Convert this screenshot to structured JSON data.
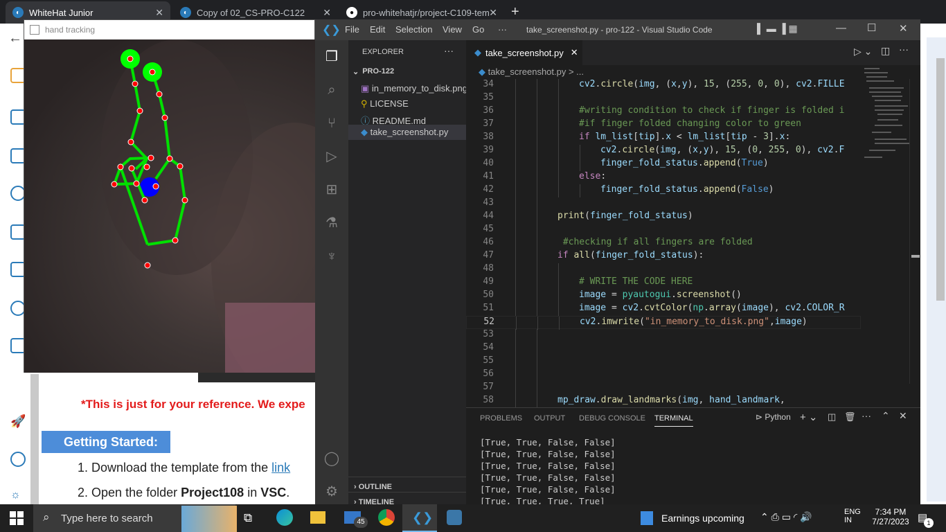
{
  "browser": {
    "tabs": [
      {
        "title": "WhiteHat Junior",
        "active": true
      },
      {
        "title": "Copy of 02_CS-PRO-C122",
        "active": false
      },
      {
        "title": "pro-whitehatjr/project-C109-tem",
        "active": false
      }
    ],
    "page": {
      "reference_text": "*This is just for your reference. We expe",
      "section_title": "Getting Started:",
      "steps": [
        {
          "num": "1.",
          "pre": "Download the template from the ",
          "link": "link",
          "bold": "",
          "post": ""
        },
        {
          "num": "2.",
          "pre": "Open the folder ",
          "link": "",
          "bold": "Project108",
          "mid": " in ",
          "bold2": "VSC",
          "post": "."
        }
      ]
    }
  },
  "hand_window": {
    "title": "hand tracking"
  },
  "vscode": {
    "title": "take_screenshot.py - pro-122 - Visual Studio Code",
    "menu": [
      "File",
      "Edit",
      "Selection",
      "View",
      "Go",
      "···"
    ],
    "explorer": {
      "header": "EXPLORER",
      "folder": "PRO-122",
      "files": [
        "in_memory_to_disk.png",
        "LICENSE",
        "README.md",
        "take_screenshot.py"
      ],
      "outline": "OUTLINE",
      "timeline": "TIMELINE"
    },
    "editor_tab": "take_screenshot.py",
    "breadcrumb": "take_screenshot.py > ...",
    "current_line": "52",
    "lines": [
      {
        "n": "34",
        "html": "<span class='vr'>cv2</span>.<span class='fn'>circle</span>(<span class='vr'>img</span>, (<span class='vr'>x</span>,<span class='vr'>y</span>), <span class='nm'>15</span>, (<span class='nm'>255</span>, <span class='nm'>0</span>, <span class='nm'>0</span>), <span class='vr'>cv2</span>.<span class='vr'>FILLE</span>",
        "indent": 4
      },
      {
        "n": "35",
        "html": "",
        "indent": 4
      },
      {
        "n": "36",
        "html": "<span class='cm'>#writing condition to check if finger is folded i</span>",
        "indent": 4
      },
      {
        "n": "37",
        "html": "<span class='cm'>#if finger folded changing color to green</span>",
        "indent": 4
      },
      {
        "n": "38",
        "html": "<span class='kw'>if</span> <span class='vr'>lm_list</span>[<span class='vr'>tip</span>].<span class='vr'>x</span> &lt; <span class='vr'>lm_list</span>[<span class='vr'>tip</span> - <span class='nm'>3</span>].<span class='vr'>x</span>:",
        "indent": 4
      },
      {
        "n": "39",
        "html": "<span class='vr'>cv2</span>.<span class='fn'>circle</span>(<span class='vr'>img</span>, (<span class='vr'>x</span>,<span class='vr'>y</span>), <span class='nm'>15</span>, (<span class='nm'>0</span>, <span class='nm'>255</span>, <span class='nm'>0</span>), <span class='vr'>cv2</span>.<span class='vr'>F</span>",
        "indent": 5
      },
      {
        "n": "40",
        "html": "<span class='vr'>finger_fold_status</span>.<span class='fn'>append</span>(<span class='bl'>True</span>)",
        "indent": 5
      },
      {
        "n": "41",
        "html": "<span class='kw'>else</span>:",
        "indent": 4
      },
      {
        "n": "42",
        "html": "<span class='vr'>finger_fold_status</span>.<span class='fn'>append</span>(<span class='bl'>False</span>)",
        "indent": 5
      },
      {
        "n": "43",
        "html": "",
        "indent": 3
      },
      {
        "n": "44",
        "html": "<span class='fn'>print</span>(<span class='vr'>finger_fold_status</span>)",
        "indent": 3
      },
      {
        "n": "45",
        "html": "",
        "indent": 3
      },
      {
        "n": "46",
        "html": " <span class='cm'>#checking if all fingers are folded</span>",
        "indent": 3
      },
      {
        "n": "47",
        "html": "<span class='kw'>if</span> <span class='fn'>all</span>(<span class='vr'>finger_fold_status</span>):",
        "indent": 3
      },
      {
        "n": "48",
        "html": "",
        "indent": 4
      },
      {
        "n": "49",
        "html": "<span class='cm'># WRITE THE CODE HERE</span>",
        "indent": 4
      },
      {
        "n": "50",
        "html": "<span class='vr'>image</span> = <span class='cl'>pyautogui</span>.<span class='fn'>screenshot</span>()",
        "indent": 4
      },
      {
        "n": "51",
        "html": "<span class='vr'>image</span> = <span class='vr'>cv2</span>.<span class='fn'>cvtColor</span>(<span class='cl'>np</span>.<span class='fn'>array</span>(<span class='vr'>image</span>), <span class='vr'>cv2</span>.<span class='vr'>COLOR_R</span>",
        "indent": 4
      },
      {
        "n": "52",
        "html": "<span class='vr'>cv2</span>.<span class='fn'>imwrite</span>(<span class='st'>\"in_memory_to_disk.png\"</span>,<span class='vr'>image</span>)",
        "indent": 4
      },
      {
        "n": "53",
        "html": "",
        "indent": 3
      },
      {
        "n": "54",
        "html": "",
        "indent": 3
      },
      {
        "n": "55",
        "html": "",
        "indent": 3
      },
      {
        "n": "56",
        "html": "",
        "indent": 3
      },
      {
        "n": "57",
        "html": "",
        "indent": 3
      },
      {
        "n": "58",
        "html": "<span class='vr'>mp_draw</span>.<span class='fn'>draw_landmarks</span>(<span class='vr'>img</span>, <span class='vr'>hand_landmark</span>,",
        "indent": 3
      }
    ],
    "panel": {
      "tabs": [
        "PROBLEMS",
        "OUTPUT",
        "DEBUG CONSOLE",
        "TERMINAL"
      ],
      "active_tab": "TERMINAL",
      "shell": "Python",
      "terminal_lines": [
        "[True, True, False, False]",
        "[True, True, False, False]",
        "[True, True, False, False]",
        "[True, True, False, False]",
        "[True, True, False, False]",
        "[True, True, True, True]"
      ]
    }
  },
  "taskbar": {
    "search_placeholder": "Type here to search",
    "mail_badge": "45",
    "weather": "Earnings upcoming",
    "lang1": "ENG",
    "lang2": "IN",
    "time": "7:34 PM",
    "date": "7/27/2023",
    "notif": "1"
  }
}
